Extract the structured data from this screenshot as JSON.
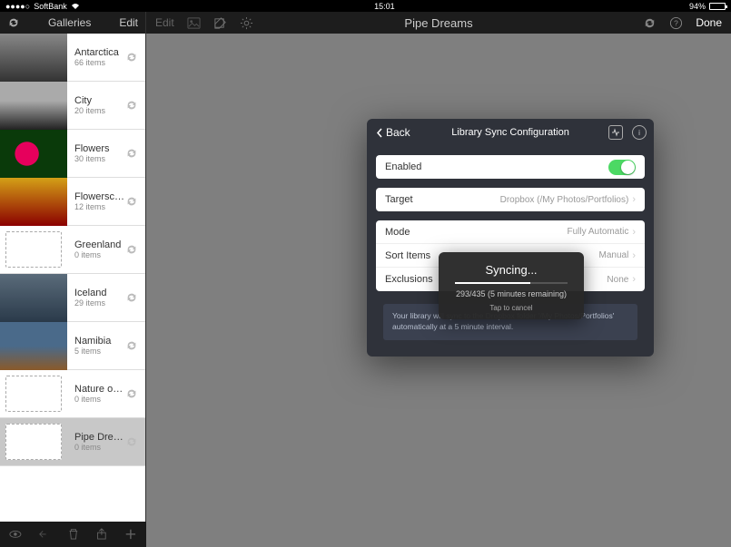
{
  "status": {
    "carrier": "SoftBank",
    "signal_dots": "●●●●○",
    "wifi": "⌔",
    "time": "15:01",
    "battery_pct": "94%"
  },
  "sidebar": {
    "header_label": "Galleries",
    "edit_label": "Edit",
    "items": [
      {
        "title": "Antarctica",
        "count": "66 items",
        "dashed": false,
        "thumb": "t-bw1"
      },
      {
        "title": "City",
        "count": "20 items",
        "dashed": false,
        "thumb": "t-bw2"
      },
      {
        "title": "Flowers",
        "count": "30 items",
        "dashed": false,
        "thumb": "t-flower"
      },
      {
        "title": "Flowersc…",
        "count": "12 items",
        "dashed": false,
        "thumb": "t-flower2"
      },
      {
        "title": "Greenland",
        "count": "0 items",
        "dashed": true,
        "thumb": ""
      },
      {
        "title": "Iceland",
        "count": "29 items",
        "dashed": false,
        "thumb": "t-ice"
      },
      {
        "title": "Namibia",
        "count": "5 items",
        "dashed": false,
        "thumb": "t-nam"
      },
      {
        "title": "Nature of…",
        "count": "0 items",
        "dashed": true,
        "thumb": ""
      },
      {
        "title": "Pipe Dre…",
        "count": "0 items",
        "dashed": true,
        "thumb": "",
        "selected": true
      }
    ]
  },
  "content": {
    "edit_label": "Edit",
    "title": "Pipe Dreams",
    "done_label": "Done"
  },
  "modal": {
    "back_label": "Back",
    "title": "Library Sync Configuration",
    "rows": {
      "enabled_label": "Enabled",
      "target_label": "Target",
      "target_value": "Dropbox (/My Photos/Portfolios)",
      "mode_label": "Mode",
      "mode_value": "Fully Automatic",
      "sort_label": "Sort Items",
      "sort_value": "Manual",
      "excl_label": "Exclusions",
      "excl_value": "None"
    },
    "info": "Your library will sync to the Dropbox folder '/My Photos/Portfolios' automatically at a 5 minute interval."
  },
  "sync": {
    "title": "Syncing...",
    "progress": "293/435 (5 minutes remaining)",
    "cancel": "Tap to cancel"
  }
}
